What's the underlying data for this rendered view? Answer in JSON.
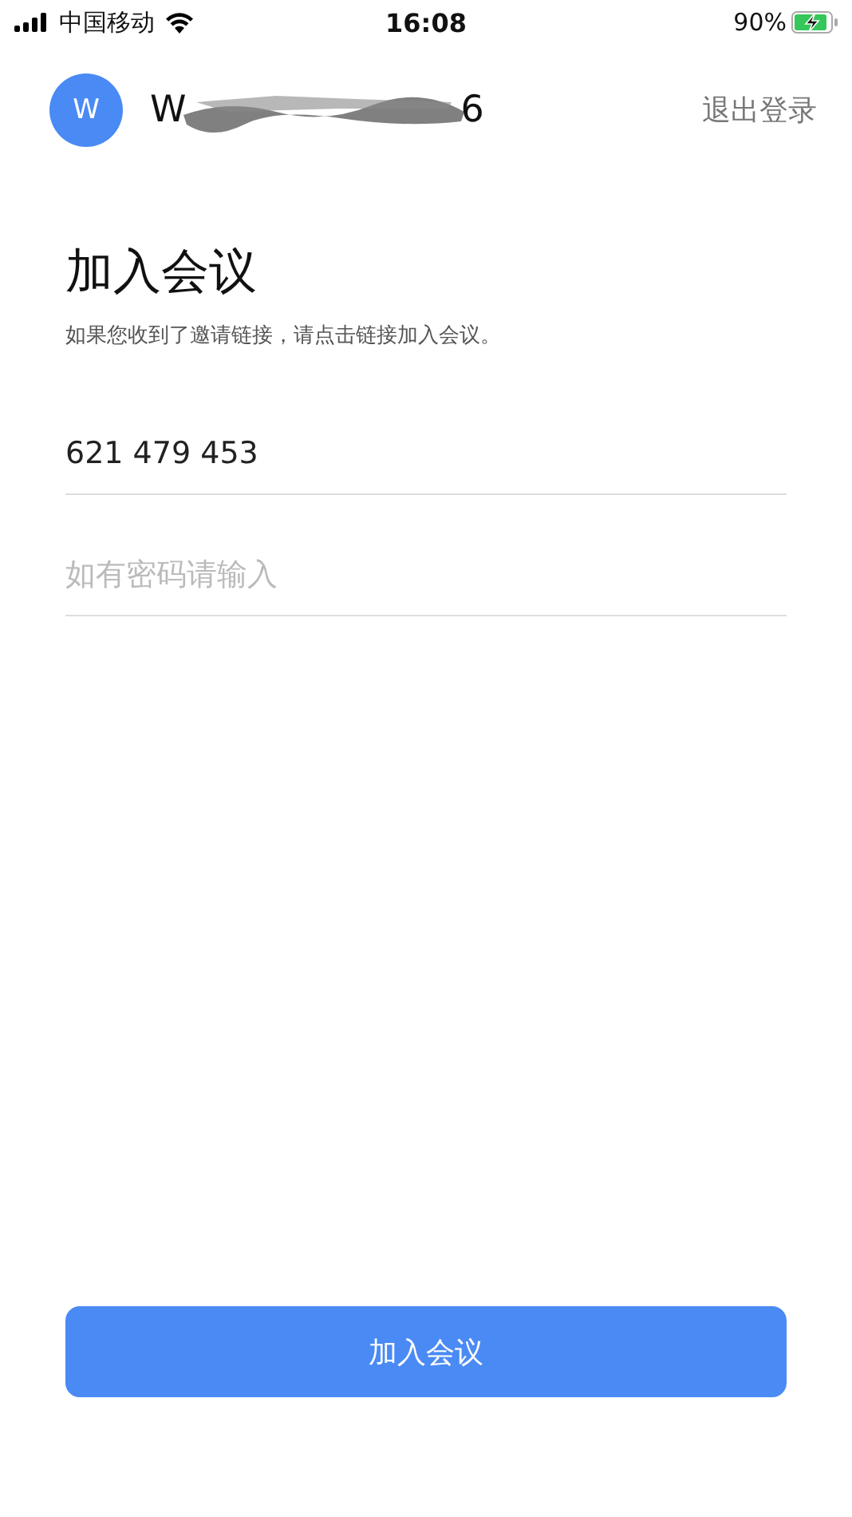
{
  "status_bar": {
    "carrier": "中国移动",
    "time": "16:08",
    "battery": "90%",
    "charging": true
  },
  "account": {
    "avatar": "W",
    "name_start": "W",
    "name_end": "6",
    "name_redacted": true,
    "logout": "退出登录"
  },
  "title": "加入会议",
  "subtitle": "如果您收到了邀请链接，请点击链接加入会议。",
  "meeting_id": {
    "value": "621 479 453"
  },
  "password": {
    "placeholder": "如有密码请输入"
  },
  "join_button": "加入会议"
}
